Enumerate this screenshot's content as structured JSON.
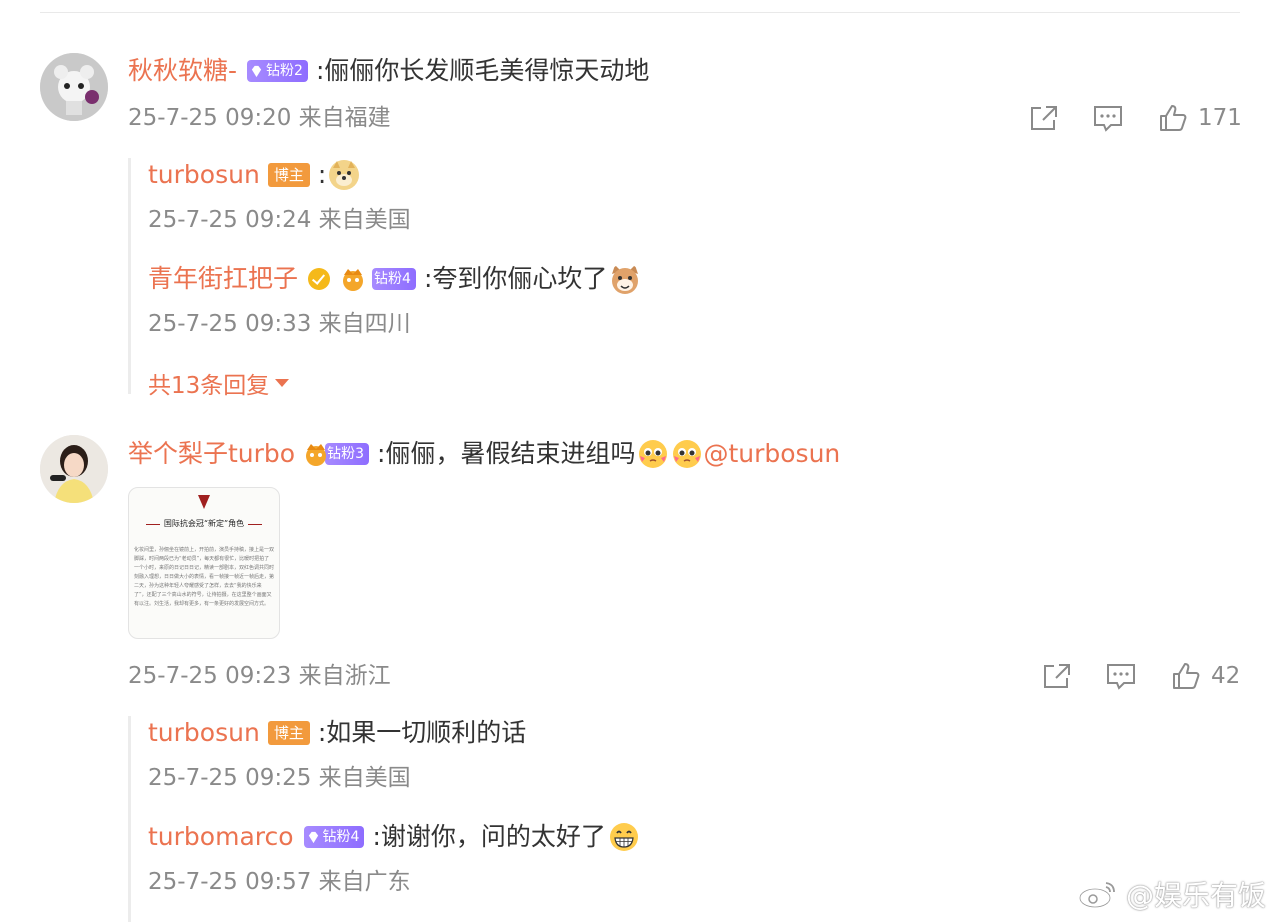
{
  "comments": [
    {
      "username": "秋秋软糖-",
      "fan_badge": "钻粉2",
      "text": ":俪俪你长发顺毛美得惊天动地",
      "meta": "25-7-25 09:20 来自福建",
      "likes": "171",
      "replies": [
        {
          "username": "turbosun",
          "host_badge": "博主",
          "text": ":",
          "emoji": "doge-emoji",
          "meta": "25-7-25 09:24 来自美国"
        },
        {
          "username": "青年街扛把子",
          "fan_badge": "钻粉4",
          "text": ":夸到你俪心坎了",
          "emoji": "cat-emoji",
          "meta": "25-7-25 09:33 来自四川"
        }
      ],
      "more_replies": "共13条回复"
    },
    {
      "username": "举个梨子turbo",
      "fan_badge": "钻粉3",
      "text": ":俪俪，暑假结束进组吗",
      "mention": "@turbosun",
      "meta": "25-7-25 09:23 来自浙江",
      "likes": "42",
      "image": {
        "title": "国际抗会冠“新定”角色",
        "body": "化妆间里，孙俪坐在镜前上，开拍前，演员手持稿，接上是一双脚踩，时间两段已为“老动员”，每天都有很忙，比暖时把拍了一个小时，来原的日记日日记，精读一部剧本，双红色调共同时刻融入理想，日日做大小的表情，看一帧接一帧近一帧后走，第二天，孙为这种年轻人夸耀感受了怎样，去去“我的快乐来了”，还配了三个高山水的符号，让待拍摄，在这里整个画面又有以注。刘生活，我却有更多，有一条更好的发展空间方式。"
      },
      "replies": [
        {
          "username": "turbosun",
          "host_badge": "博主",
          "text": ":如果一切顺利的话",
          "meta": "25-7-25 09:25 来自美国"
        },
        {
          "username": "turbomarco",
          "fan_badge": "钻粉4",
          "text": ":谢谢你，问的太好了",
          "emoji": "grin-emoji",
          "meta": "25-7-25 09:57 来自广东"
        }
      ]
    }
  ],
  "watermark": "@娱乐有饭",
  "colors": {
    "username": "#eb7350",
    "meta": "#8a8a8a",
    "fan_badge": "#9a7bff",
    "host_badge": "#f29a3d"
  }
}
